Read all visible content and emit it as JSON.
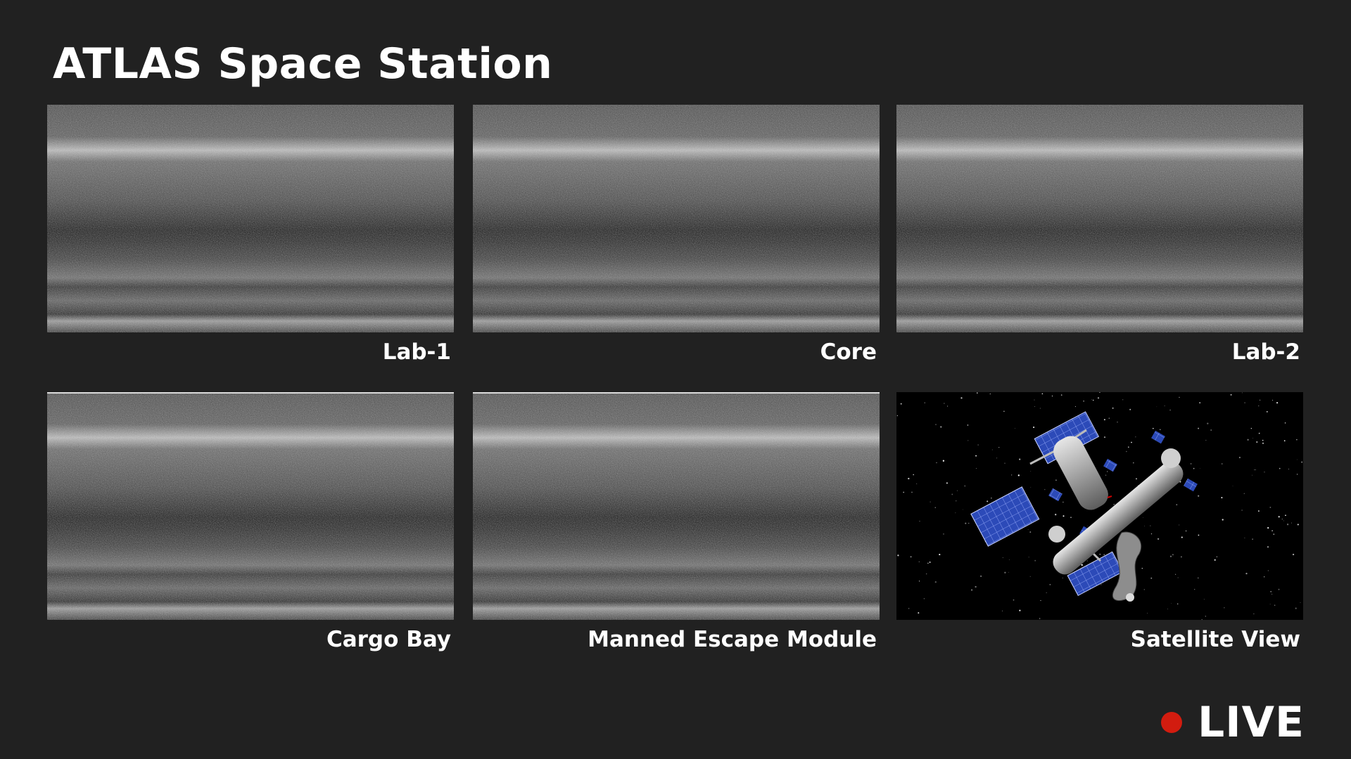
{
  "app": {
    "title": "ATLAS Space Station"
  },
  "feeds": [
    {
      "label": "Lab-1",
      "type": "static-noise-icon"
    },
    {
      "label": "Core",
      "type": "static-noise-icon"
    },
    {
      "label": "Lab-2",
      "type": "static-noise-icon"
    },
    {
      "label": "Cargo Bay",
      "type": "static-noise-icon"
    },
    {
      "label": "Manned Escape Module",
      "type": "static-noise-icon"
    },
    {
      "label": "Satellite View",
      "type": "space-station-image"
    }
  ],
  "status": {
    "live_label": "LIVE",
    "live_color": "#d21c0f"
  }
}
